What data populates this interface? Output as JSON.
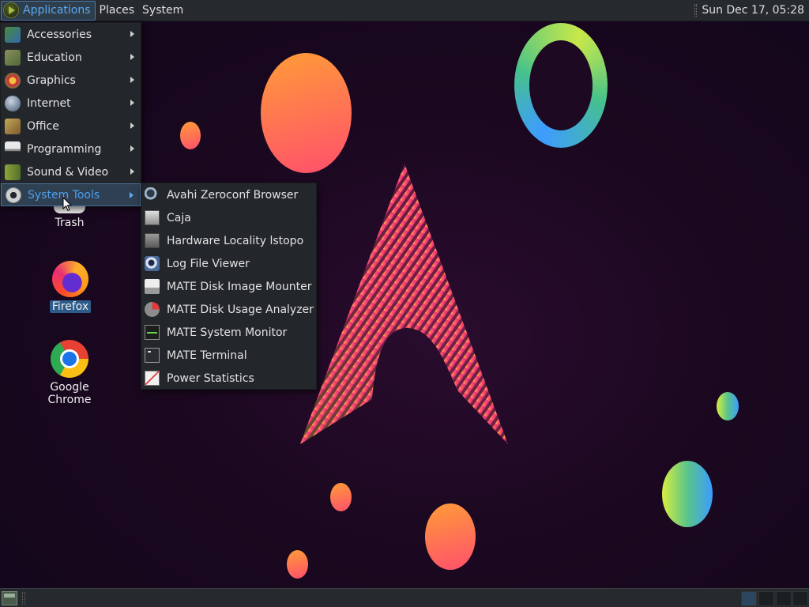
{
  "top_panel": {
    "applications": "Applications",
    "places": "Places",
    "system": "System",
    "clock": "Sun Dec 17, 05:28"
  },
  "menu": {
    "items": [
      {
        "label": "Accessories",
        "icon": "accessories-icon"
      },
      {
        "label": "Education",
        "icon": "education-icon"
      },
      {
        "label": "Graphics",
        "icon": "graphics-icon"
      },
      {
        "label": "Internet",
        "icon": "internet-icon"
      },
      {
        "label": "Office",
        "icon": "office-icon"
      },
      {
        "label": "Programming",
        "icon": "programming-icon"
      },
      {
        "label": "Sound & Video",
        "icon": "sound-video-icon"
      },
      {
        "label": "System Tools",
        "icon": "system-tools-icon",
        "active": true
      }
    ]
  },
  "submenu": {
    "items": [
      {
        "label": "Avahi Zeroconf Browser",
        "icon": "avahi-icon"
      },
      {
        "label": "Caja",
        "icon": "caja-icon"
      },
      {
        "label": "Hardware Locality lstopo",
        "icon": "hardware-icon"
      },
      {
        "label": "Log File Viewer",
        "icon": "log-viewer-icon"
      },
      {
        "label": "MATE Disk Image Mounter",
        "icon": "disk-mounter-icon"
      },
      {
        "label": "MATE Disk Usage Analyzer",
        "icon": "disk-usage-icon"
      },
      {
        "label": "MATE System Monitor",
        "icon": "system-monitor-icon"
      },
      {
        "label": "MATE Terminal",
        "icon": "terminal-icon"
      },
      {
        "label": "Power Statistics",
        "icon": "power-statistics-icon"
      }
    ]
  },
  "desktop_icons": {
    "trash": "Trash",
    "firefox": "Firefox",
    "chrome": "Google Chrome"
  },
  "colors": {
    "panel": "#262a2e",
    "accent": "#4ea0f0",
    "menu_bg": "#23272b"
  }
}
